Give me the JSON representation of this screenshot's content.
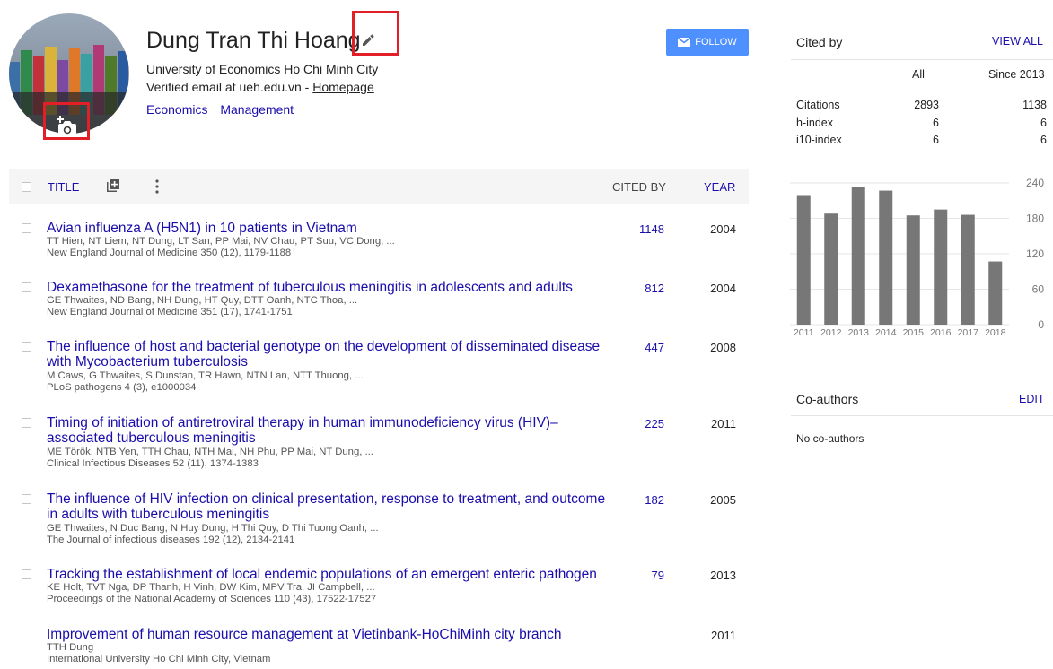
{
  "profile": {
    "name": "Dung Tran Thi Hoang",
    "affiliation": "University of Economics Ho Chi Minh City",
    "email_text": "Verified email at ueh.edu.vn - ",
    "homepage_label": "Homepage",
    "interests": [
      "Economics",
      "Management"
    ],
    "follow_label": "FOLLOW",
    "accent_color": "#4d90fe",
    "highlight_color": "#e21f26"
  },
  "table": {
    "headers": {
      "title": "TITLE",
      "cited_by": "CITED BY",
      "year": "YEAR"
    },
    "rows": [
      {
        "title": "Avian influenza A (H5N1) in 10 patients in Vietnam",
        "authors": "TT Hien, NT Liem, NT Dung, LT San, PP Mai, NV Chau, PT Suu, VC Dong, ...",
        "venue": "New England Journal of Medicine 350 (12), 1179-1188",
        "cited": "1148",
        "year": "2004"
      },
      {
        "title": "Dexamethasone for the treatment of tuberculous meningitis in adolescents and adults",
        "authors": "GE Thwaites, ND Bang, NH Dung, HT Quy, DTT Oanh, NTC Thoa, ...",
        "venue": "New England Journal of Medicine 351 (17), 1741-1751",
        "cited": "812",
        "year": "2004"
      },
      {
        "title": "The influence of host and bacterial genotype on the development of disseminated disease with Mycobacterium tuberculosis",
        "authors": "M Caws, G Thwaites, S Dunstan, TR Hawn, NTN Lan, NTT Thuong, ...",
        "venue": "PLoS pathogens 4 (3), e1000034",
        "cited": "447",
        "year": "2008"
      },
      {
        "title": "Timing of initiation of antiretroviral therapy in human immunodeficiency virus (HIV)–associated tuberculous meningitis",
        "authors": "ME Török, NTB Yen, TTH Chau, NTH Mai, NH Phu, PP Mai, NT Dung, ...",
        "venue": "Clinical Infectious Diseases 52 (11), 1374-1383",
        "cited": "225",
        "year": "2011"
      },
      {
        "title": "The influence of HIV infection on clinical presentation, response to treatment, and outcome in adults with tuberculous meningitis",
        "authors": "GE Thwaites, N Duc Bang, N Huy Dung, H Thi Quy, D Thi Tuong Oanh, ...",
        "venue": "The Journal of infectious diseases 192 (12), 2134-2141",
        "cited": "182",
        "year": "2005"
      },
      {
        "title": "Tracking the establishment of local endemic populations of an emergent enteric pathogen",
        "authors": "KE Holt, TVT Nga, DP Thanh, H Vinh, DW Kim, MPV Tra, JI Campbell, ...",
        "venue": "Proceedings of the National Academy of Sciences 110 (43), 17522-17527",
        "cited": "79",
        "year": "2013"
      },
      {
        "title": "Improvement of human resource management at Vietinbank-HoChiMinh city branch",
        "authors": "TTH Dung",
        "venue": "International University Ho Chi Minh City, Vietnam",
        "cited": "",
        "year": "2011"
      }
    ]
  },
  "cited_by": {
    "heading": "Cited by",
    "view_all": "VIEW ALL",
    "col_all": "All",
    "col_since": "Since 2013",
    "stats": [
      {
        "label": "Citations",
        "all": "2893",
        "since": "1138"
      },
      {
        "label": "h-index",
        "all": "6",
        "since": "6"
      },
      {
        "label": "i10-index",
        "all": "6",
        "since": "6"
      }
    ]
  },
  "chart_data": {
    "type": "bar",
    "categories": [
      "2011",
      "2012",
      "2013",
      "2014",
      "2015",
      "2016",
      "2017",
      "2018"
    ],
    "values": [
      218,
      188,
      233,
      227,
      185,
      195,
      186,
      107
    ],
    "yticks": [
      "240",
      "180",
      "120",
      "60",
      "0"
    ],
    "ylim": [
      0,
      240
    ],
    "bar_color": "#777777",
    "grid": true
  },
  "coauthors": {
    "heading": "Co-authors",
    "edit_label": "EDIT",
    "empty_text": "No co-authors"
  }
}
